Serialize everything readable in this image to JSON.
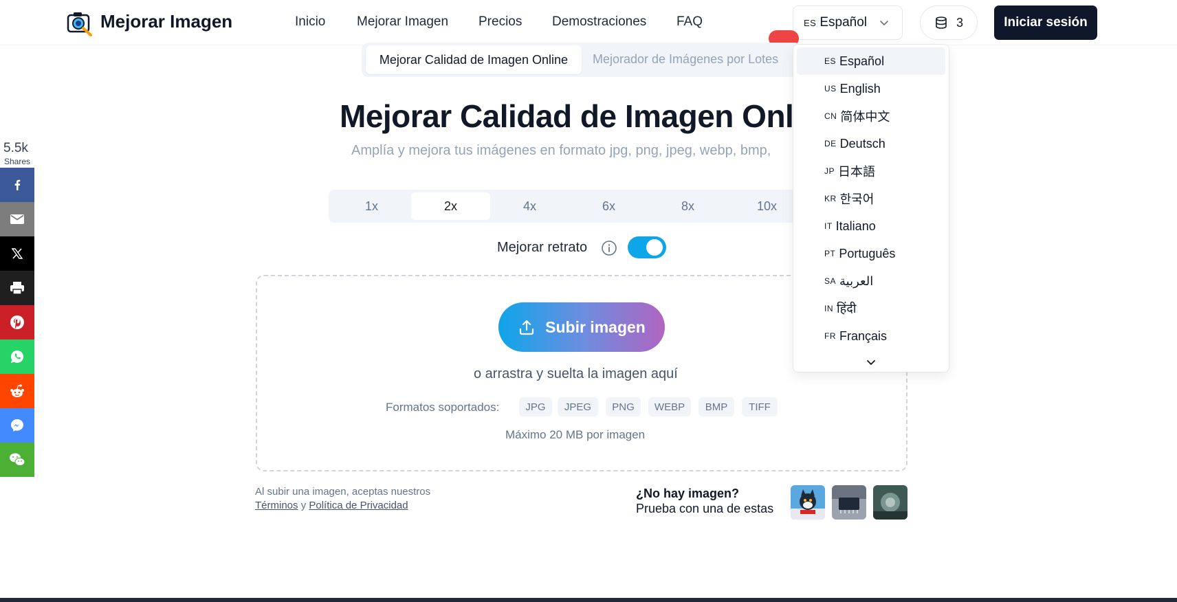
{
  "brand": {
    "name": "Mejorar Imagen"
  },
  "nav": [
    {
      "label": "Inicio"
    },
    {
      "label": "Mejorar Imagen"
    },
    {
      "label": "Precios"
    },
    {
      "label": "Demostraciones"
    },
    {
      "label": "FAQ"
    }
  ],
  "language_select": {
    "code": "ES",
    "label": "Español"
  },
  "credits": {
    "count": "3",
    "icon": "database-icon"
  },
  "login": {
    "label": "Iniciar sesión"
  },
  "mode_tabs": [
    {
      "label": "Mejorar Calidad de Imagen Online",
      "active": true
    },
    {
      "label": "Mejorador de Imágenes por Lotes",
      "active": false
    }
  ],
  "hero": {
    "title": "Mejorar Calidad de Imagen Onli",
    "subtitle": "Amplía y mejora tus imágenes en formato jpg, png, jpeg, webp, bmp,"
  },
  "scales": [
    {
      "label": "1x"
    },
    {
      "label": "2x",
      "active": true
    },
    {
      "label": "4x"
    },
    {
      "label": "6x"
    },
    {
      "label": "8x"
    },
    {
      "label": "10x"
    }
  ],
  "portrait": {
    "label": "Mejorar retrato",
    "enabled": true
  },
  "upload": {
    "button_label": "Subir imagen",
    "drag_text": "o arrastra y suelta la imagen aquí",
    "formats_label": "Formatos soportados:",
    "formats": [
      "JPG",
      "JPEG",
      "PNG",
      "WEBP",
      "BMP",
      "TIFF"
    ],
    "max_text": "Máximo 20 MB por imagen"
  },
  "terms": {
    "line1": "Al subir una imagen, aceptas nuestros",
    "terms_link": "Términos",
    "and": "y",
    "privacy_link": "Política de Privacidad"
  },
  "samples": {
    "title": "¿No hay imagen?",
    "subtitle": "Prueba con una de estas"
  },
  "share": {
    "count": "5.5k",
    "label": "Shares",
    "buttons": [
      {
        "icon": "facebook-icon",
        "color": "#3b5998"
      },
      {
        "icon": "email-icon",
        "color": "#7d7d7d"
      },
      {
        "icon": "x-icon",
        "color": "#000000"
      },
      {
        "icon": "print-icon",
        "color": "#1f1f1f"
      },
      {
        "icon": "pinterest-icon",
        "color": "#cb2027"
      },
      {
        "icon": "whatsapp-icon",
        "color": "#25d366"
      },
      {
        "icon": "reddit-icon",
        "color": "#ff4500"
      },
      {
        "icon": "messenger-icon",
        "color": "#448aff"
      },
      {
        "icon": "wechat-icon",
        "color": "#4cb035"
      }
    ]
  },
  "language_menu": [
    {
      "code": "ES",
      "label": "Español",
      "selected": true
    },
    {
      "code": "US",
      "label": "English"
    },
    {
      "code": "CN",
      "label": "简体中文"
    },
    {
      "code": "DE",
      "label": "Deutsch"
    },
    {
      "code": "JP",
      "label": "日本語"
    },
    {
      "code": "KR",
      "label": "한국어"
    },
    {
      "code": "IT",
      "label": "Italiano"
    },
    {
      "code": "PT",
      "label": "Português"
    },
    {
      "code": "SA",
      "label": "العربية"
    },
    {
      "code": "IN",
      "label": "हिंदी"
    },
    {
      "code": "FR",
      "label": "Français"
    }
  ],
  "colors": {
    "accent": "#0ea5e9",
    "primary_dark": "#0f172a",
    "gradient_end": "#b065c0"
  }
}
